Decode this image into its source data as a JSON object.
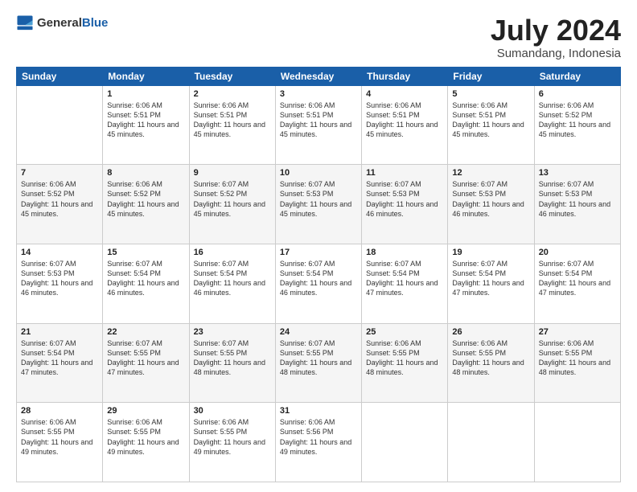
{
  "header": {
    "logo": {
      "general": "General",
      "blue": "Blue"
    },
    "title": "July 2024",
    "subtitle": "Sumandang, Indonesia"
  },
  "days_of_week": [
    "Sunday",
    "Monday",
    "Tuesday",
    "Wednesday",
    "Thursday",
    "Friday",
    "Saturday"
  ],
  "weeks": [
    [
      {
        "day": "",
        "sunrise": "",
        "sunset": "",
        "daylight": ""
      },
      {
        "day": "1",
        "sunrise": "Sunrise: 6:06 AM",
        "sunset": "Sunset: 5:51 PM",
        "daylight": "Daylight: 11 hours and 45 minutes."
      },
      {
        "day": "2",
        "sunrise": "Sunrise: 6:06 AM",
        "sunset": "Sunset: 5:51 PM",
        "daylight": "Daylight: 11 hours and 45 minutes."
      },
      {
        "day": "3",
        "sunrise": "Sunrise: 6:06 AM",
        "sunset": "Sunset: 5:51 PM",
        "daylight": "Daylight: 11 hours and 45 minutes."
      },
      {
        "day": "4",
        "sunrise": "Sunrise: 6:06 AM",
        "sunset": "Sunset: 5:51 PM",
        "daylight": "Daylight: 11 hours and 45 minutes."
      },
      {
        "day": "5",
        "sunrise": "Sunrise: 6:06 AM",
        "sunset": "Sunset: 5:51 PM",
        "daylight": "Daylight: 11 hours and 45 minutes."
      },
      {
        "day": "6",
        "sunrise": "Sunrise: 6:06 AM",
        "sunset": "Sunset: 5:52 PM",
        "daylight": "Daylight: 11 hours and 45 minutes."
      }
    ],
    [
      {
        "day": "7",
        "sunrise": "Sunrise: 6:06 AM",
        "sunset": "Sunset: 5:52 PM",
        "daylight": "Daylight: 11 hours and 45 minutes."
      },
      {
        "day": "8",
        "sunrise": "Sunrise: 6:06 AM",
        "sunset": "Sunset: 5:52 PM",
        "daylight": "Daylight: 11 hours and 45 minutes."
      },
      {
        "day": "9",
        "sunrise": "Sunrise: 6:07 AM",
        "sunset": "Sunset: 5:52 PM",
        "daylight": "Daylight: 11 hours and 45 minutes."
      },
      {
        "day": "10",
        "sunrise": "Sunrise: 6:07 AM",
        "sunset": "Sunset: 5:53 PM",
        "daylight": "Daylight: 11 hours and 45 minutes."
      },
      {
        "day": "11",
        "sunrise": "Sunrise: 6:07 AM",
        "sunset": "Sunset: 5:53 PM",
        "daylight": "Daylight: 11 hours and 46 minutes."
      },
      {
        "day": "12",
        "sunrise": "Sunrise: 6:07 AM",
        "sunset": "Sunset: 5:53 PM",
        "daylight": "Daylight: 11 hours and 46 minutes."
      },
      {
        "day": "13",
        "sunrise": "Sunrise: 6:07 AM",
        "sunset": "Sunset: 5:53 PM",
        "daylight": "Daylight: 11 hours and 46 minutes."
      }
    ],
    [
      {
        "day": "14",
        "sunrise": "Sunrise: 6:07 AM",
        "sunset": "Sunset: 5:53 PM",
        "daylight": "Daylight: 11 hours and 46 minutes."
      },
      {
        "day": "15",
        "sunrise": "Sunrise: 6:07 AM",
        "sunset": "Sunset: 5:54 PM",
        "daylight": "Daylight: 11 hours and 46 minutes."
      },
      {
        "day": "16",
        "sunrise": "Sunrise: 6:07 AM",
        "sunset": "Sunset: 5:54 PM",
        "daylight": "Daylight: 11 hours and 46 minutes."
      },
      {
        "day": "17",
        "sunrise": "Sunrise: 6:07 AM",
        "sunset": "Sunset: 5:54 PM",
        "daylight": "Daylight: 11 hours and 46 minutes."
      },
      {
        "day": "18",
        "sunrise": "Sunrise: 6:07 AM",
        "sunset": "Sunset: 5:54 PM",
        "daylight": "Daylight: 11 hours and 47 minutes."
      },
      {
        "day": "19",
        "sunrise": "Sunrise: 6:07 AM",
        "sunset": "Sunset: 5:54 PM",
        "daylight": "Daylight: 11 hours and 47 minutes."
      },
      {
        "day": "20",
        "sunrise": "Sunrise: 6:07 AM",
        "sunset": "Sunset: 5:54 PM",
        "daylight": "Daylight: 11 hours and 47 minutes."
      }
    ],
    [
      {
        "day": "21",
        "sunrise": "Sunrise: 6:07 AM",
        "sunset": "Sunset: 5:54 PM",
        "daylight": "Daylight: 11 hours and 47 minutes."
      },
      {
        "day": "22",
        "sunrise": "Sunrise: 6:07 AM",
        "sunset": "Sunset: 5:55 PM",
        "daylight": "Daylight: 11 hours and 47 minutes."
      },
      {
        "day": "23",
        "sunrise": "Sunrise: 6:07 AM",
        "sunset": "Sunset: 5:55 PM",
        "daylight": "Daylight: 11 hours and 48 minutes."
      },
      {
        "day": "24",
        "sunrise": "Sunrise: 6:07 AM",
        "sunset": "Sunset: 5:55 PM",
        "daylight": "Daylight: 11 hours and 48 minutes."
      },
      {
        "day": "25",
        "sunrise": "Sunrise: 6:06 AM",
        "sunset": "Sunset: 5:55 PM",
        "daylight": "Daylight: 11 hours and 48 minutes."
      },
      {
        "day": "26",
        "sunrise": "Sunrise: 6:06 AM",
        "sunset": "Sunset: 5:55 PM",
        "daylight": "Daylight: 11 hours and 48 minutes."
      },
      {
        "day": "27",
        "sunrise": "Sunrise: 6:06 AM",
        "sunset": "Sunset: 5:55 PM",
        "daylight": "Daylight: 11 hours and 48 minutes."
      }
    ],
    [
      {
        "day": "28",
        "sunrise": "Sunrise: 6:06 AM",
        "sunset": "Sunset: 5:55 PM",
        "daylight": "Daylight: 11 hours and 49 minutes."
      },
      {
        "day": "29",
        "sunrise": "Sunrise: 6:06 AM",
        "sunset": "Sunset: 5:55 PM",
        "daylight": "Daylight: 11 hours and 49 minutes."
      },
      {
        "day": "30",
        "sunrise": "Sunrise: 6:06 AM",
        "sunset": "Sunset: 5:55 PM",
        "daylight": "Daylight: 11 hours and 49 minutes."
      },
      {
        "day": "31",
        "sunrise": "Sunrise: 6:06 AM",
        "sunset": "Sunset: 5:56 PM",
        "daylight": "Daylight: 11 hours and 49 minutes."
      },
      {
        "day": "",
        "sunrise": "",
        "sunset": "",
        "daylight": ""
      },
      {
        "day": "",
        "sunrise": "",
        "sunset": "",
        "daylight": ""
      },
      {
        "day": "",
        "sunrise": "",
        "sunset": "",
        "daylight": ""
      }
    ]
  ]
}
